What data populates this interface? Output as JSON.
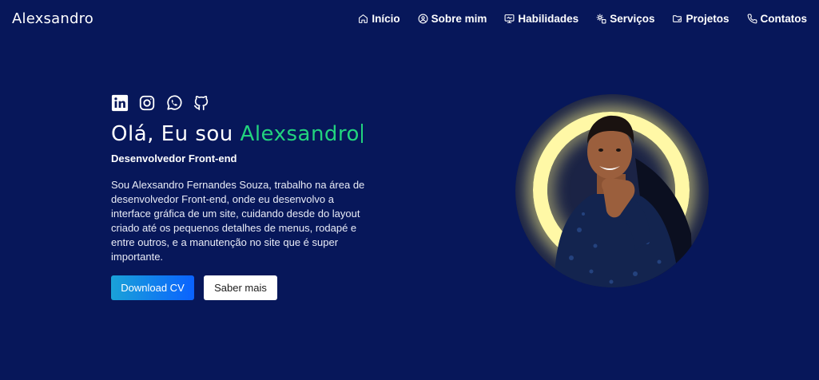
{
  "brand": "Alexsandro",
  "nav": [
    {
      "label": "Início",
      "icon": "home-icon"
    },
    {
      "label": "Sobre mim",
      "icon": "user-circle-icon"
    },
    {
      "label": "Habilidades",
      "icon": "monitor-icon"
    },
    {
      "label": "Serviços",
      "icon": "services-icon"
    },
    {
      "label": "Projetos",
      "icon": "folder-icon"
    },
    {
      "label": "Contatos",
      "icon": "phone-icon"
    }
  ],
  "socials": [
    "linkedin-icon",
    "instagram-icon",
    "whatsapp-icon",
    "github-icon"
  ],
  "hero": {
    "greeting": "Olá, Eu sou ",
    "name": "Alexsandro",
    "role": "Desenvolvedor Front-end",
    "bio": "Sou Alexsandro Fernandes Souza, trabalho na área de desenvolvedor Front-end, onde eu desenvolvo a interface gráfica de um site, cuidando desde do layout criado até os pequenos detalhes de menus, rodapé e entre outros, e a manutenção no site que é super importante.",
    "download_label": "Download CV",
    "more_label": "Saber mais"
  },
  "colors": {
    "background": "#07175a",
    "accent_green": "#22d37e",
    "button_gradient_start": "#1aa2d8",
    "button_gradient_end": "#0a62ff",
    "glow": "#fff8a6"
  }
}
